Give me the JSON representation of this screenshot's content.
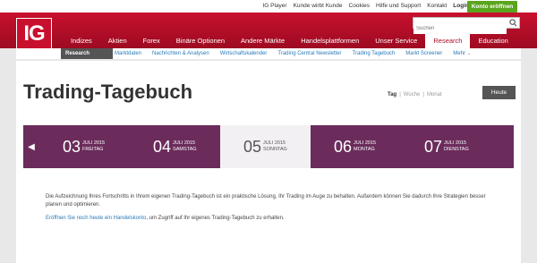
{
  "top_links": [
    "IG Player",
    "Kunde wirbt Kunde",
    "Cookies",
    "Hilfe und Support",
    "Kontakt"
  ],
  "login": "Login",
  "cta": "Konto eröffnen",
  "logo": "IG",
  "search": {
    "placeholder": "Suchen"
  },
  "main_nav": [
    "Indizes",
    "Aktien",
    "Forex",
    "Binäre Optionen",
    "Andere Märkte",
    "Handelsplattformen",
    "Unser Service",
    "Research",
    "Education"
  ],
  "main_nav_active": "Research",
  "sub_nav": {
    "badge": "Research",
    "items": [
      "Marktdaten",
      "Nachrichten & Analysen",
      "Wirtschaftskalender",
      "Trading Central Newsletter",
      "Trading Tagebuch",
      "Markt Screener",
      "Mehr"
    ]
  },
  "page": {
    "title": "Trading-Tagebuch",
    "views": [
      "Tag",
      "Woche",
      "Monat"
    ],
    "view_active": "Tag",
    "today_button": "Heute"
  },
  "days": [
    {
      "num": "03",
      "month": "JULI 2015",
      "weekday": "FREITAG"
    },
    {
      "num": "04",
      "month": "JULI 2015",
      "weekday": "SAMSTAG"
    },
    {
      "num": "05",
      "month": "JULI 2015",
      "weekday": "SONNTAG"
    },
    {
      "num": "06",
      "month": "JULI 2015",
      "weekday": "MONTAG"
    },
    {
      "num": "07",
      "month": "JULI 2015",
      "weekday": "DIENSTAG"
    }
  ],
  "active_day": "05",
  "body": {
    "paragraph1": "Die Aufzeichnung Ihres Fortschritts in Ihrem eigenen Trading-Tagebuch ist ein praktische Lösung, Ihr Trading im Auge zu behalten. Außerdem können Sie dadurch Ihre Strategien besser planen und optimieren.",
    "link": "Eröffnen Sie noch heute ein Handelskonto",
    "paragraph2_rest": ", um Zugriff auf Ihr eigenes Trading-Tagebuch zu erhalten."
  },
  "colors": {
    "brand_red": "#c8102e",
    "calendar_purple": "#6b2c5c",
    "cta_green": "#5aa51e",
    "link_blue": "#2a7ab8"
  }
}
